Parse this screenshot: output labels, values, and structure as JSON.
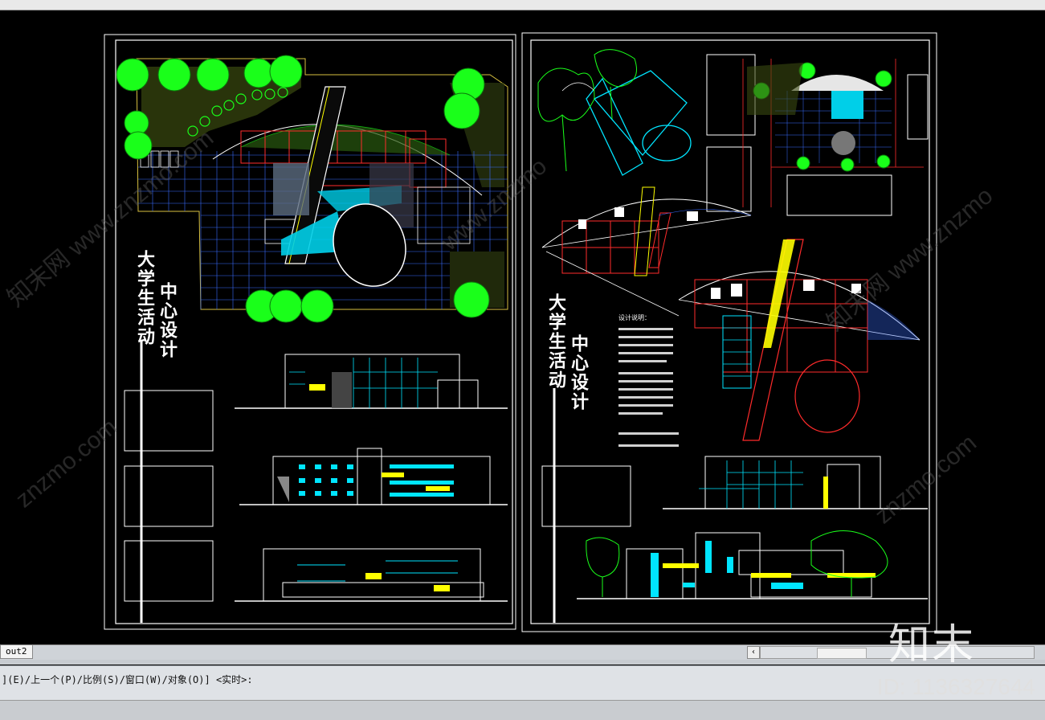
{
  "layout_tab": {
    "label": "out2"
  },
  "command": {
    "text": "](E)/上一个(P)/比例(S)/窗口(W)/对象(O)] <实时>:"
  },
  "watermark": {
    "id_text": "ID: 1136327644",
    "logo_text": "知末",
    "site_text": "www.znzmo.com"
  },
  "sheet_left": {
    "title_vertical": "大学生活动",
    "title_vertical2": "中心设计"
  },
  "sheet_right": {
    "title_vertical": "大学生活动",
    "title_vertical2": "中心设计",
    "notes_title": "设计说明："
  },
  "colors": {
    "cyan": "#00e5ff",
    "green": "#1aff1a",
    "yellow": "#ffff00",
    "red": "#ff2b2b",
    "white": "#ffffff",
    "blue": "#3a6cff",
    "magenta": "#ff3cff"
  }
}
